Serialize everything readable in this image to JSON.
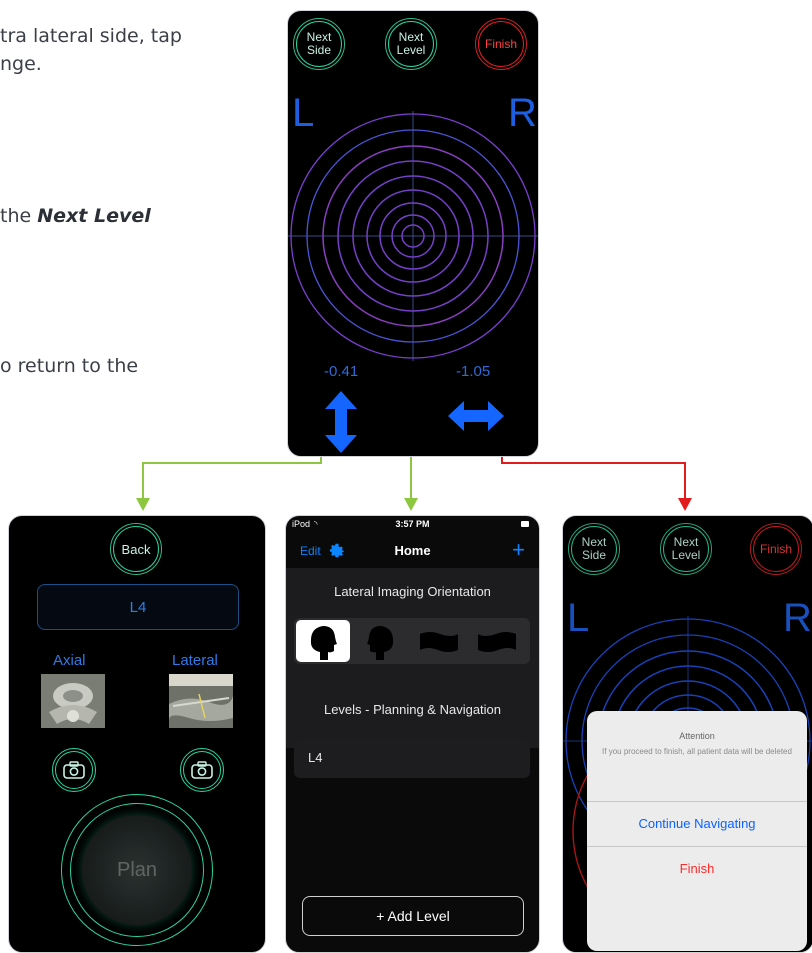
{
  "document": {
    "line1": "tra lateral side, tap",
    "line2": "nge.",
    "line3_prefix": "the ",
    "line3_bold": "Next Level",
    "line4": "o return to the"
  },
  "navigation_screen": {
    "next_side": "Next\nSide",
    "next_level": "Next\nLevel",
    "finish": "Finish",
    "left": "L",
    "right": "R",
    "value_vertical": "-0.41",
    "value_horizontal": "-1.05",
    "vertical_icon": "up-down-arrow-icon",
    "horizontal_icon": "left-right-arrow-icon"
  },
  "level_screen": {
    "back": "Back",
    "level": "L4",
    "axial": "Axial",
    "lateral": "Lateral",
    "plan": "Plan"
  },
  "home_screen": {
    "status_device": "iPod",
    "status_time": "3:57 PM",
    "edit": "Edit",
    "title": "Home",
    "add_icon": "+",
    "section_orientation": "Lateral Imaging Orientation",
    "section_levels": "Levels - Planning & Navigation",
    "levels": [
      "L4"
    ],
    "add_level": "+ Add Level"
  },
  "finish_screen": {
    "next_side": "Next\nSide",
    "next_level": "Next\nLevel",
    "finish": "Finish",
    "left": "L",
    "right": "R",
    "alert_title": "Attention",
    "alert_message": "If you proceed to finish, all patient data will be deleted",
    "continue": "Continue Navigating",
    "finish_action": "Finish"
  },
  "colors": {
    "green_ring": "#2ad3a0",
    "red_ring": "#e51e1e",
    "ios_blue": "#0a84ff",
    "arrow_green": "#8dc63f",
    "arrow_red": "#e21b1b"
  }
}
